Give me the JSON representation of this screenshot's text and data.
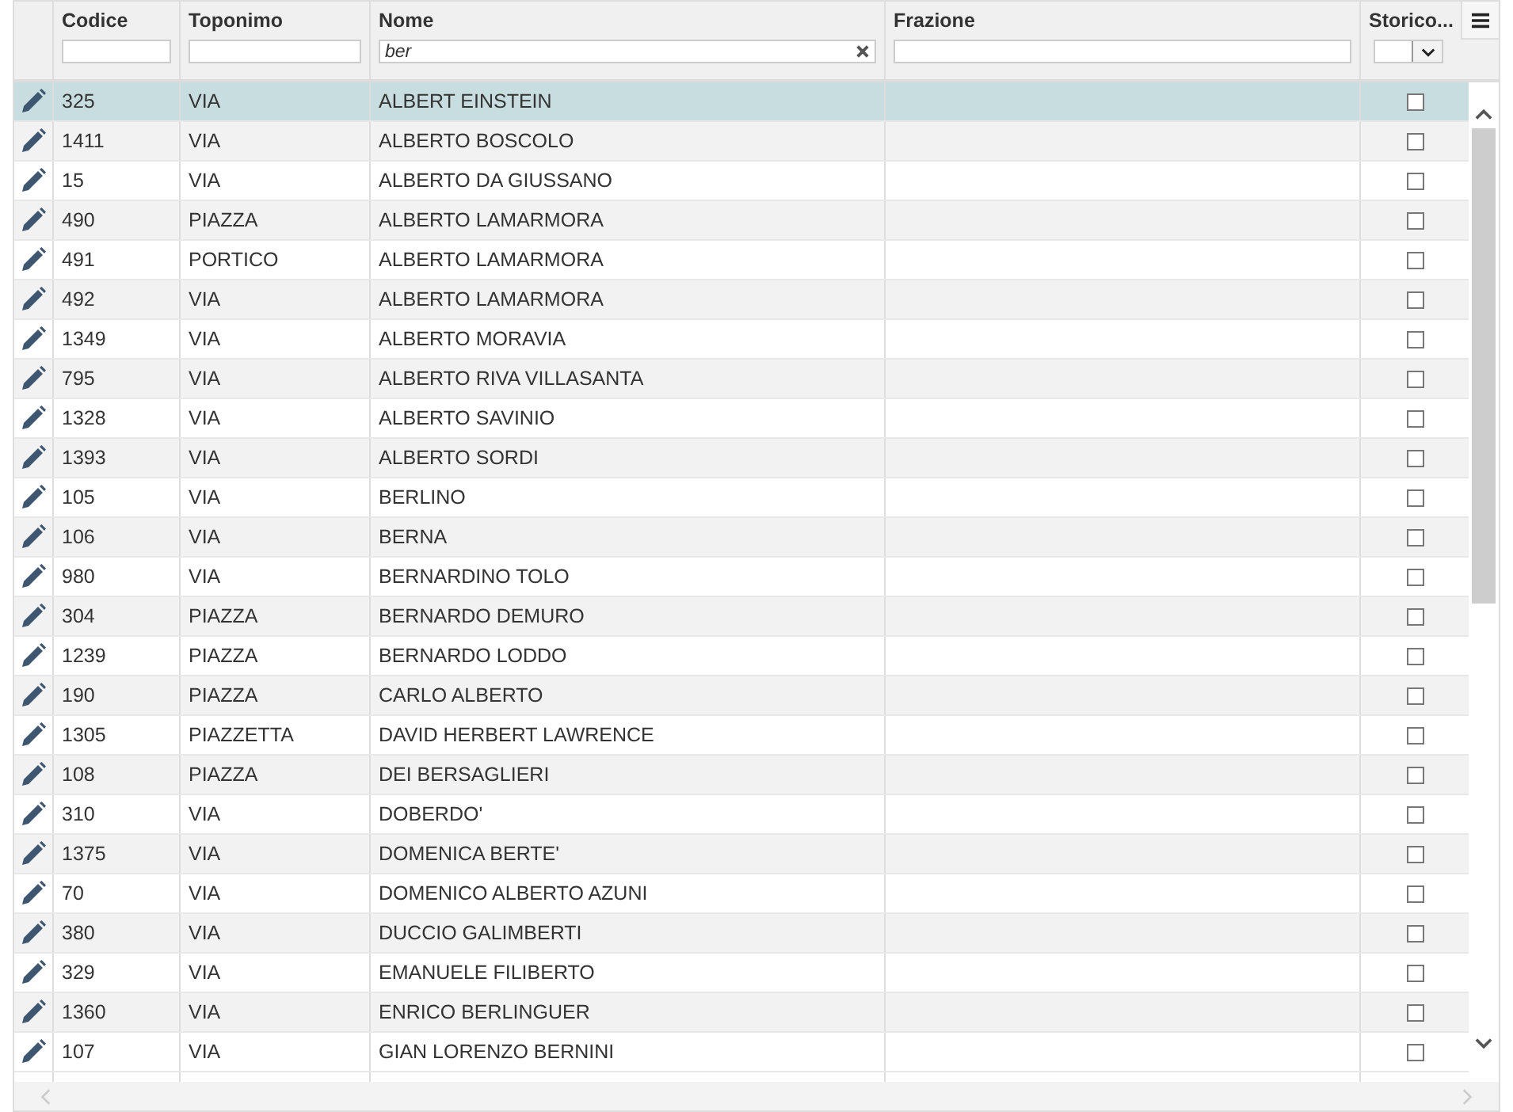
{
  "columns": [
    {
      "label": "Codice",
      "filter": {
        "kind": "text"
      }
    },
    {
      "label": "Toponimo",
      "filter": {
        "kind": "text"
      }
    },
    {
      "label": "Nome",
      "filter": {
        "kind": "text",
        "value": "ber",
        "clearable": true
      }
    },
    {
      "label": "Frazione",
      "filter": {
        "kind": "text"
      }
    },
    {
      "label": "Storico...",
      "filter": {
        "kind": "select"
      }
    }
  ],
  "rows": [
    {
      "codice": "325",
      "toponimo": "VIA",
      "nome": "ALBERT EINSTEIN",
      "storico": false,
      "selected": true
    },
    {
      "codice": "1411",
      "toponimo": "VIA",
      "nome": "ALBERTO BOSCOLO",
      "storico": false,
      "selected": false
    },
    {
      "codice": "15",
      "toponimo": "VIA",
      "nome": "ALBERTO DA GIUSSANO",
      "storico": false,
      "selected": false
    },
    {
      "codice": "490",
      "toponimo": "PIAZZA",
      "nome": "ALBERTO LAMARMORA",
      "storico": false,
      "selected": false
    },
    {
      "codice": "491",
      "toponimo": "PORTICO",
      "nome": "ALBERTO LAMARMORA",
      "storico": false,
      "selected": false
    },
    {
      "codice": "492",
      "toponimo": "VIA",
      "nome": "ALBERTO LAMARMORA",
      "storico": false,
      "selected": false
    },
    {
      "codice": "1349",
      "toponimo": "VIA",
      "nome": "ALBERTO MORAVIA",
      "storico": false,
      "selected": false
    },
    {
      "codice": "795",
      "toponimo": "VIA",
      "nome": "ALBERTO RIVA VILLASANTA",
      "storico": false,
      "selected": false
    },
    {
      "codice": "1328",
      "toponimo": "VIA",
      "nome": "ALBERTO SAVINIO",
      "storico": false,
      "selected": false
    },
    {
      "codice": "1393",
      "toponimo": "VIA",
      "nome": "ALBERTO SORDI",
      "storico": false,
      "selected": false
    },
    {
      "codice": "105",
      "toponimo": "VIA",
      "nome": "BERLINO",
      "storico": false,
      "selected": false
    },
    {
      "codice": "106",
      "toponimo": "VIA",
      "nome": "BERNA",
      "storico": false,
      "selected": false
    },
    {
      "codice": "980",
      "toponimo": "VIA",
      "nome": "BERNARDINO TOLO",
      "storico": false,
      "selected": false
    },
    {
      "codice": "304",
      "toponimo": "PIAZZA",
      "nome": "BERNARDO DEMURO",
      "storico": false,
      "selected": false
    },
    {
      "codice": "1239",
      "toponimo": "PIAZZA",
      "nome": "BERNARDO LODDO",
      "storico": false,
      "selected": false
    },
    {
      "codice": "190",
      "toponimo": "PIAZZA",
      "nome": "CARLO ALBERTO",
      "storico": false,
      "selected": false
    },
    {
      "codice": "1305",
      "toponimo": "PIAZZETTA",
      "nome": "DAVID HERBERT LAWRENCE",
      "storico": false,
      "selected": false
    },
    {
      "codice": "108",
      "toponimo": "PIAZZA",
      "nome": "DEI BERSAGLIERI",
      "storico": false,
      "selected": false
    },
    {
      "codice": "310",
      "toponimo": "VIA",
      "nome": "DOBERDO'",
      "storico": false,
      "selected": false
    },
    {
      "codice": "1375",
      "toponimo": "VIA",
      "nome": "DOMENICA BERTE'",
      "storico": false,
      "selected": false
    },
    {
      "codice": "70",
      "toponimo": "VIA",
      "nome": "DOMENICO ALBERTO AZUNI",
      "storico": false,
      "selected": false
    },
    {
      "codice": "380",
      "toponimo": "VIA",
      "nome": "DUCCIO GALIMBERTI",
      "storico": false,
      "selected": false
    },
    {
      "codice": "329",
      "toponimo": "VIA",
      "nome": "EMANUELE FILIBERTO",
      "storico": false,
      "selected": false
    },
    {
      "codice": "1360",
      "toponimo": "VIA",
      "nome": "ENRICO BERLINGUER",
      "storico": false,
      "selected": false
    },
    {
      "codice": "107",
      "toponimo": "VIA",
      "nome": "GIAN LORENZO BERNINI",
      "storico": false,
      "selected": false
    }
  ]
}
